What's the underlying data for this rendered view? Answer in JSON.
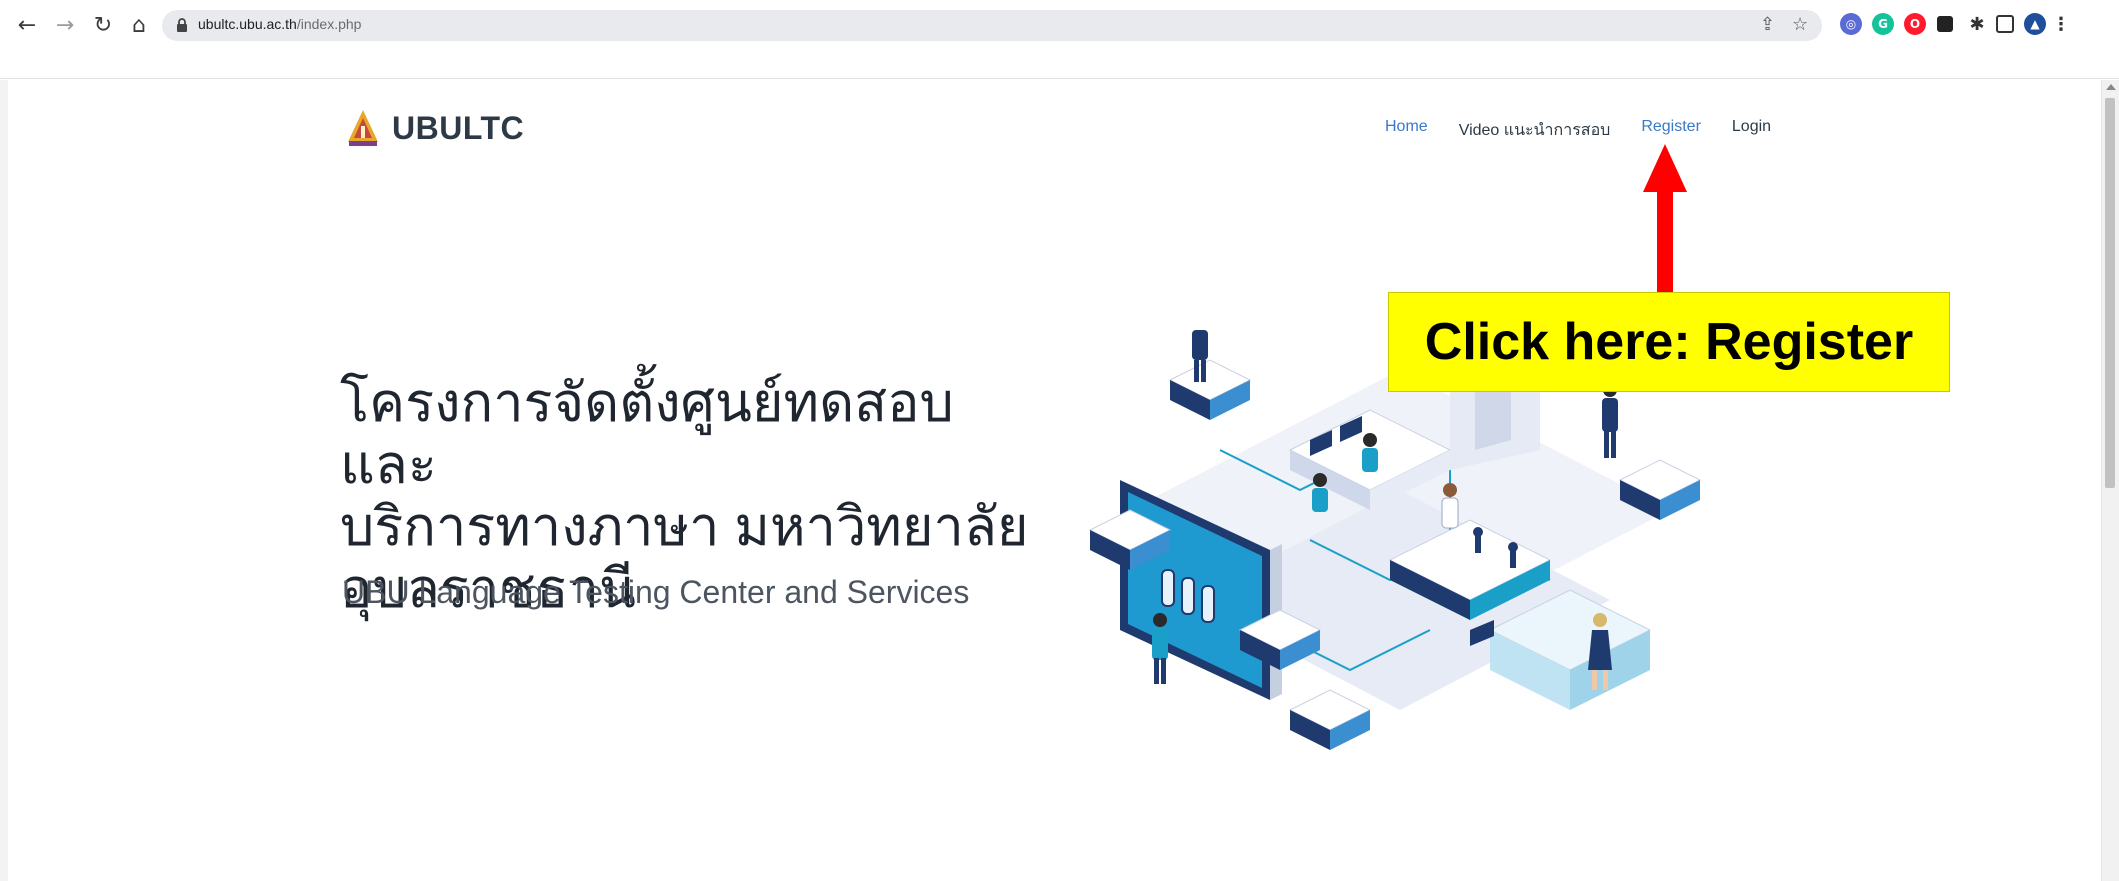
{
  "browser": {
    "url_host": "ubultc.ubu.ac.th",
    "url_path": "/index.php",
    "icons": [
      "back-icon",
      "forward-icon",
      "reload-icon",
      "home-icon",
      "lock-icon",
      "share-icon",
      "star-icon"
    ],
    "extensions": [
      "extension-1-icon",
      "grammarly-icon",
      "opera-icon",
      "extension-square-icon",
      "puzzle-icon",
      "side-panel-icon",
      "profile-avatar",
      "more-menu-icon"
    ]
  },
  "site": {
    "logo_text": "UBULTC",
    "nav": {
      "home": "Home",
      "video": "Video แนะนำการสอบ",
      "register": "Register",
      "login": "Login"
    },
    "accent_color": "#3a78c8"
  },
  "hero": {
    "title_line1": "โครงการจัดตั้งศูนย์ทดสอบและ",
    "title_line2": "บริการทางภาษา มหาวิทยาลัย",
    "title_line3": "อุบลราชธานี",
    "subtitle": "UBU Language Testing Center and Services"
  },
  "annotation": {
    "callout_text": "Click here: Register",
    "callout_color": "#ffff00",
    "arrow_color": "#ff0000"
  }
}
